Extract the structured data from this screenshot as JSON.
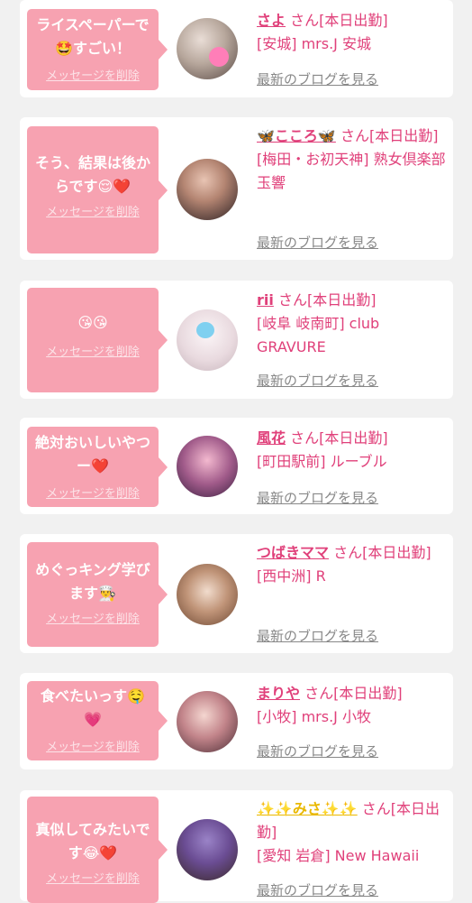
{
  "delete_label": "メッセージを削除",
  "blog_label": "最新のブログを見る",
  "san_label": "さん[本日出勤]",
  "cards": [
    {
      "msg": [
        "ライスペーパーで",
        "🤩すごい！"
      ],
      "name": "さよ",
      "shop": "[安城] mrs.J 安城"
    },
    {
      "msg": [
        "そう、結果は後か",
        "らです😌❤️"
      ],
      "name": "🦋こころ🦋",
      "shop": "[梅田・お初天神] 熟女倶楽部 玉響"
    },
    {
      "msg": [
        "😘😘"
      ],
      "name": "rii",
      "shop": "[岐阜 岐南町] club GRAVURE"
    },
    {
      "msg": [
        "絶対おいしいやつ",
        "ー❤️"
      ],
      "name": "風花",
      "shop": "[町田駅前] ルーブル"
    },
    {
      "msg": [
        "めぐっキング学び",
        "ます👨‍🍳"
      ],
      "name": "つばきママ",
      "shop": "[西中洲] R"
    },
    {
      "msg": [
        "食べたいっす🤤",
        "💗"
      ],
      "name": "まりや",
      "shop": "[小牧] mrs.J 小牧"
    },
    {
      "msg": [
        "真似してみたいで",
        "す😂❤️"
      ],
      "name": "✨✨みさ✨✨",
      "shop": "[愛知 岩倉] New Hawaii"
    }
  ],
  "colors": {
    "accent": "#e0407a",
    "bubble": "#f7a2b1",
    "background": "#f1f1f1"
  }
}
